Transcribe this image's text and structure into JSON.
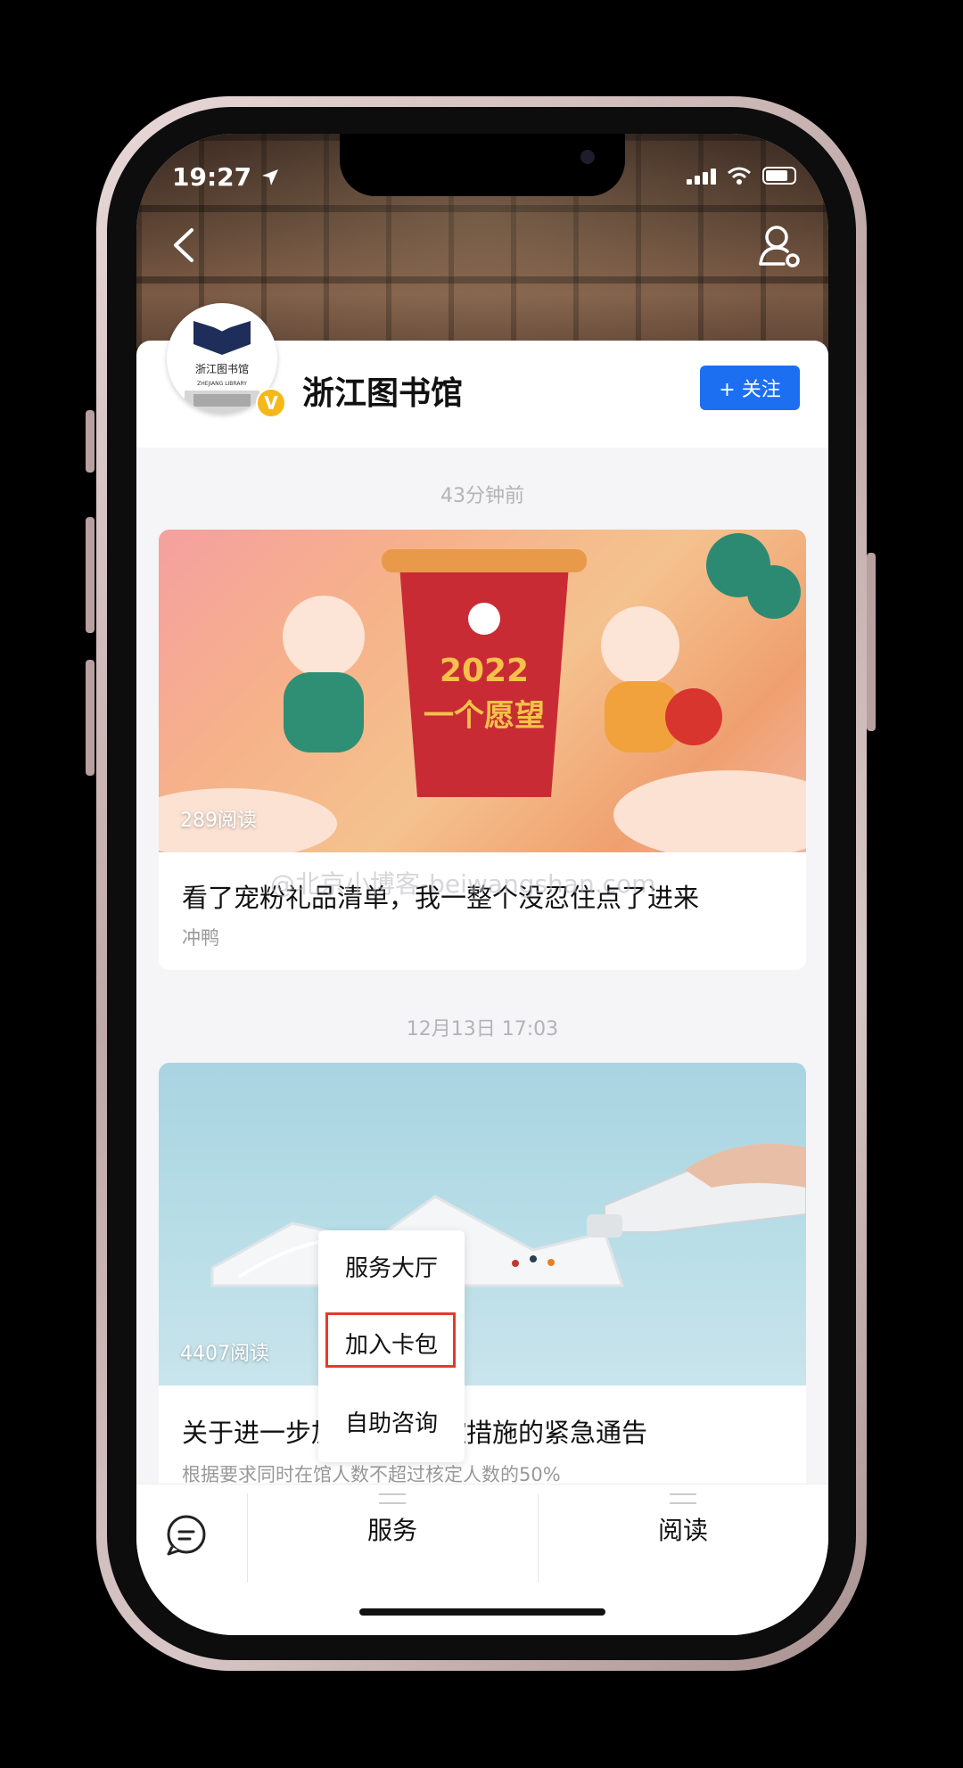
{
  "status_bar": {
    "time": "19:27"
  },
  "account": {
    "name": "浙江图书馆",
    "logo_text": "浙江图书馆",
    "logo_subtext": "ZHEJIANG LIBRARY",
    "verified_badge": "V",
    "follow_label": "+ 关注"
  },
  "feed": {
    "posts": [
      {
        "timestamp": "43分钟前",
        "reads": "289阅读",
        "title": "看了宠粉礼品清单，我一整个没忍住点了进来",
        "subtitle": "冲鸭",
        "image_text": "2022",
        "image_caption": "一个愿望"
      },
      {
        "timestamp": "12月13日  17:03",
        "reads": "4407阅读",
        "title": "关于进一步加强疫情防控措施的紧急通告",
        "subtitle": "根据要求同时在馆人数不超过核定人数的50%"
      }
    ]
  },
  "watermark": "@北京小博客-beiwangshan.com",
  "popup_menu": {
    "items": [
      "服务大厅",
      "加入卡包",
      "自助咨询"
    ],
    "highlighted_index": 1
  },
  "bottom_bar": {
    "tabs": [
      "服务",
      "阅读"
    ]
  },
  "colors": {
    "accent": "#1d6ff2",
    "highlight": "#e33a2c",
    "verified": "#f5b818"
  }
}
